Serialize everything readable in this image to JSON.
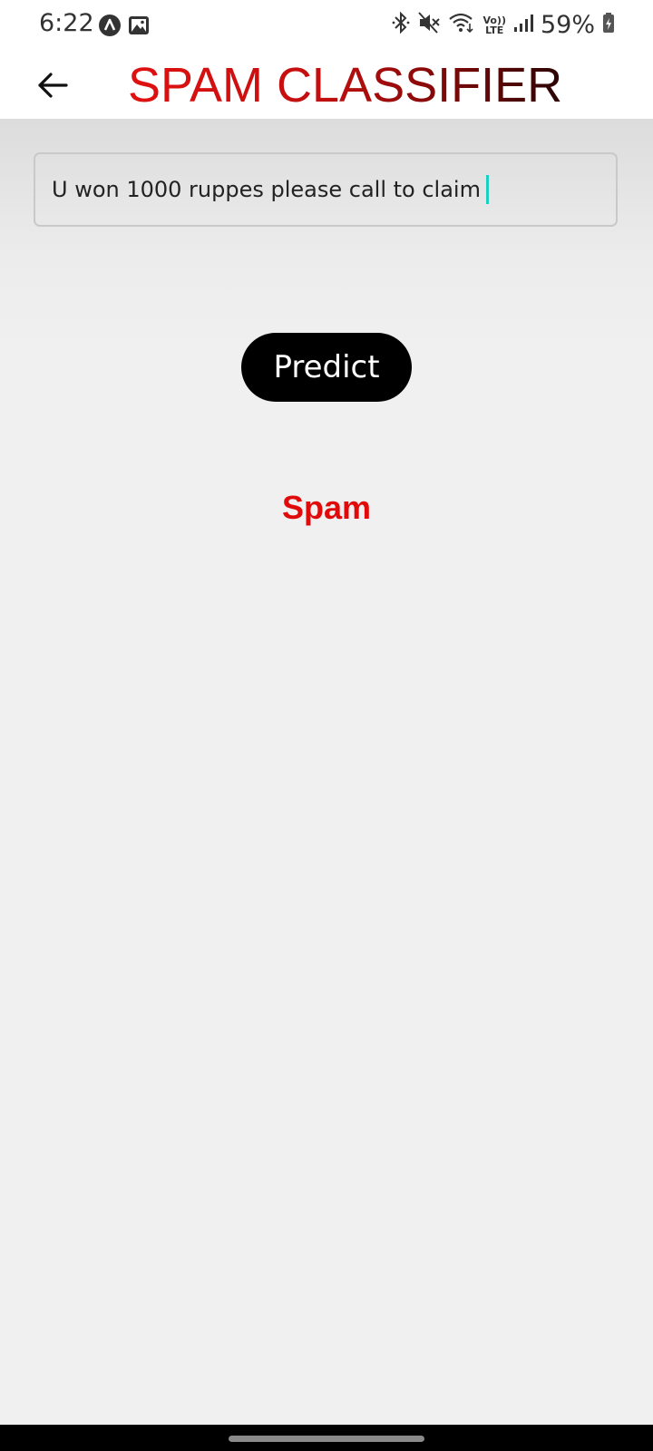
{
  "status_bar": {
    "time": "6:22",
    "battery_percent": "59%",
    "left_icons": [
      "app-notification-icon",
      "image-icon"
    ],
    "right_icons": [
      "bluetooth-icon",
      "mute-icon",
      "wifi-icon",
      "volte-icon",
      "signal-icon",
      "battery-icon"
    ],
    "volte_label_top": "Vo))",
    "volte_label_bottom": "LTE"
  },
  "app_bar": {
    "title": "SPAM CLASSIFIER",
    "back_icon": "back-arrow-icon"
  },
  "form": {
    "message_value": "U won 1000 ruppes please call to claim",
    "predict_label": "Predict"
  },
  "result": {
    "label": "Spam",
    "color": "#e00a0a"
  },
  "colors": {
    "title_gradient_start": "#e01010",
    "title_gradient_end": "#2a0404",
    "caret": "#1ccfc0",
    "button_bg": "#000000"
  }
}
